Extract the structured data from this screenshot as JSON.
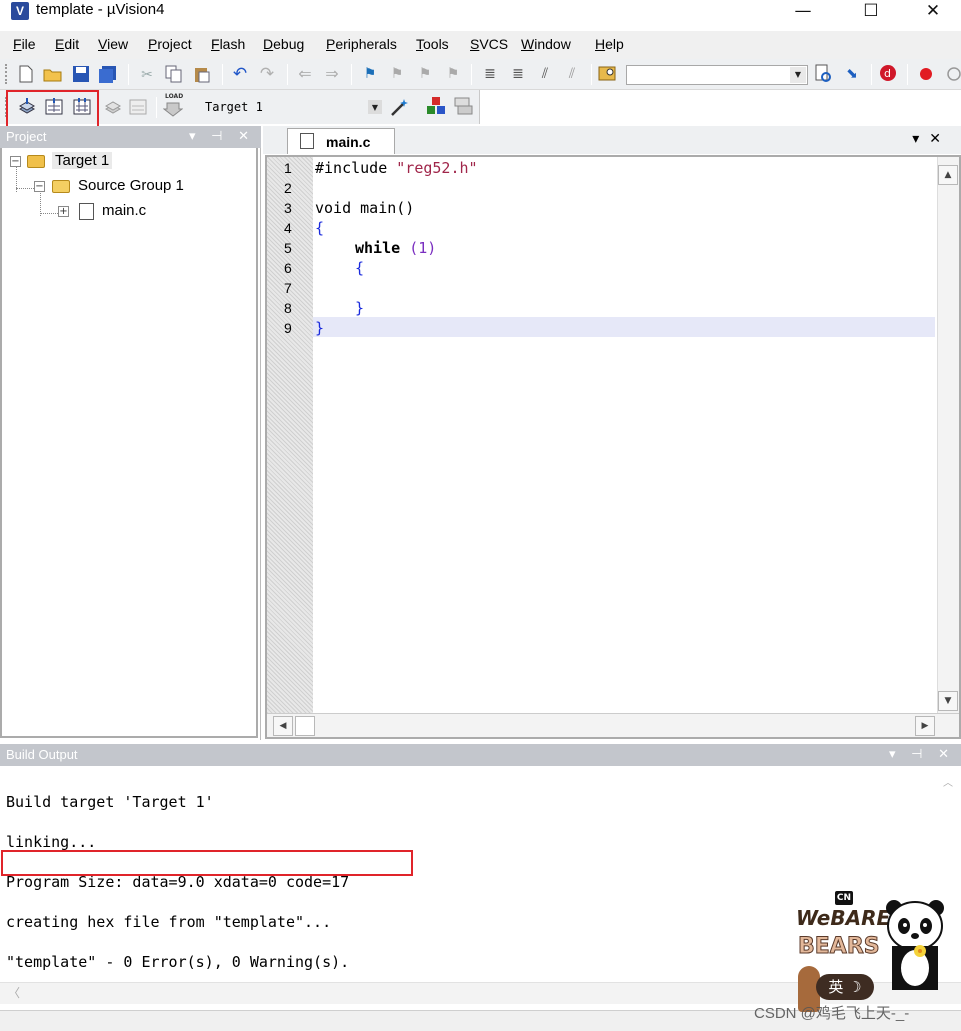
{
  "window": {
    "title": "template  - µVision4",
    "minimize": "—",
    "maximize": "☐",
    "close": "✕"
  },
  "menu": [
    "File",
    "Edit",
    "View",
    "Project",
    "Flash",
    "Debug",
    "Peripherals",
    "Tools",
    "SVCS",
    "Window",
    "Help"
  ],
  "build_toolbar": {
    "target": "Target 1",
    "load_label": "LOAD"
  },
  "project_panel": {
    "title": "Project",
    "tree": {
      "target": "Target 1",
      "group": "Source Group 1",
      "file": "main.c"
    }
  },
  "editor": {
    "tab": "main.c",
    "line_numbers": [
      "1",
      "2",
      "3",
      "4",
      "5",
      "6",
      "7",
      "8",
      "9"
    ],
    "code": {
      "l1_kw": "#include ",
      "l1_str": "\"reg52.h\"",
      "l3": "void main()",
      "l4": "{",
      "l5_kw": "while ",
      "l5_num": "(1)",
      "l6": "{",
      "l8": "}",
      "l9": "}"
    }
  },
  "build_output": {
    "title": "Build Output",
    "lines": [
      "Build target 'Target 1'",
      "linking...",
      "Program Size: data=9.0 xdata=0 code=17",
      "creating hex file from \"template\"...",
      "\"template\" - 0 Error(s), 0 Warning(s)."
    ]
  },
  "sticker": {
    "brand": "CN",
    "line1": "WeBARE",
    "line2": "BEARS",
    "ime": "英 ☽"
  },
  "watermark": "CSDN @鸡毛飞上天-_-",
  "colors": {
    "highlight": "#e0242a",
    "current_line": "#e6e8f8",
    "panel_header": "#c3c6cc",
    "string": "#a0264a",
    "brace": "#1a2adc"
  }
}
